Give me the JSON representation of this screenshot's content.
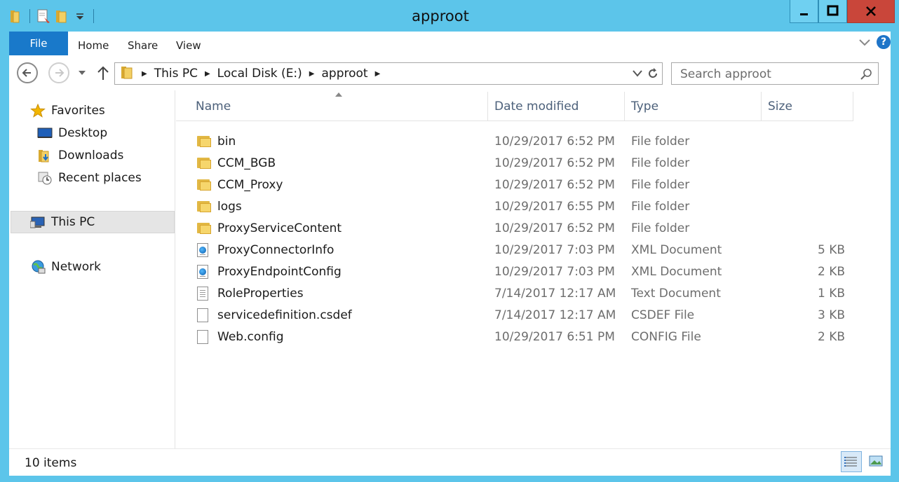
{
  "window": {
    "title": "approot",
    "minimize_glyph": "–",
    "maximize_glyph": "□",
    "close_glyph": "✕"
  },
  "ribbon": {
    "file": "File",
    "tabs": [
      "Home",
      "Share",
      "View"
    ],
    "help_glyph": "?"
  },
  "address": {
    "crumbs": [
      "This PC",
      "Local Disk (E:)",
      "approot"
    ],
    "search_placeholder": "Search approot"
  },
  "nav": {
    "favorites": "Favorites",
    "desktop": "Desktop",
    "downloads": "Downloads",
    "recent": "Recent places",
    "this_pc": "This PC",
    "network": "Network"
  },
  "columns": {
    "name": "Name",
    "date": "Date modified",
    "type": "Type",
    "size": "Size"
  },
  "files": [
    {
      "name": "bin",
      "date": "10/29/2017 6:52 PM",
      "type": "File folder",
      "size": "",
      "icon": "folder"
    },
    {
      "name": "CCM_BGB",
      "date": "10/29/2017 6:52 PM",
      "type": "File folder",
      "size": "",
      "icon": "folder"
    },
    {
      "name": "CCM_Proxy",
      "date": "10/29/2017 6:52 PM",
      "type": "File folder",
      "size": "",
      "icon": "folder"
    },
    {
      "name": "logs",
      "date": "10/29/2017 6:55 PM",
      "type": "File folder",
      "size": "",
      "icon": "folder"
    },
    {
      "name": "ProxyServiceContent",
      "date": "10/29/2017 6:52 PM",
      "type": "File folder",
      "size": "",
      "icon": "folder"
    },
    {
      "name": "ProxyConnectorInfo",
      "date": "10/29/2017 7:03 PM",
      "type": "XML Document",
      "size": "5 KB",
      "icon": "xml"
    },
    {
      "name": "ProxyEndpointConfig",
      "date": "10/29/2017 7:03 PM",
      "type": "XML Document",
      "size": "2 KB",
      "icon": "xml"
    },
    {
      "name": "RoleProperties",
      "date": "7/14/2017 12:17 AM",
      "type": "Text Document",
      "size": "1 KB",
      "icon": "text"
    },
    {
      "name": "servicedefinition.csdef",
      "date": "7/14/2017 12:17 AM",
      "type": "CSDEF File",
      "size": "3 KB",
      "icon": "blank"
    },
    {
      "name": "Web.config",
      "date": "10/29/2017 6:51 PM",
      "type": "CONFIG File",
      "size": "2 KB",
      "icon": "blank"
    }
  ],
  "status": {
    "count": "10 items"
  },
  "colors": {
    "frame": "#5cc5ea",
    "file_tab": "#1979ca",
    "close_button": "#c9463a",
    "folder": "#f6d66c"
  }
}
